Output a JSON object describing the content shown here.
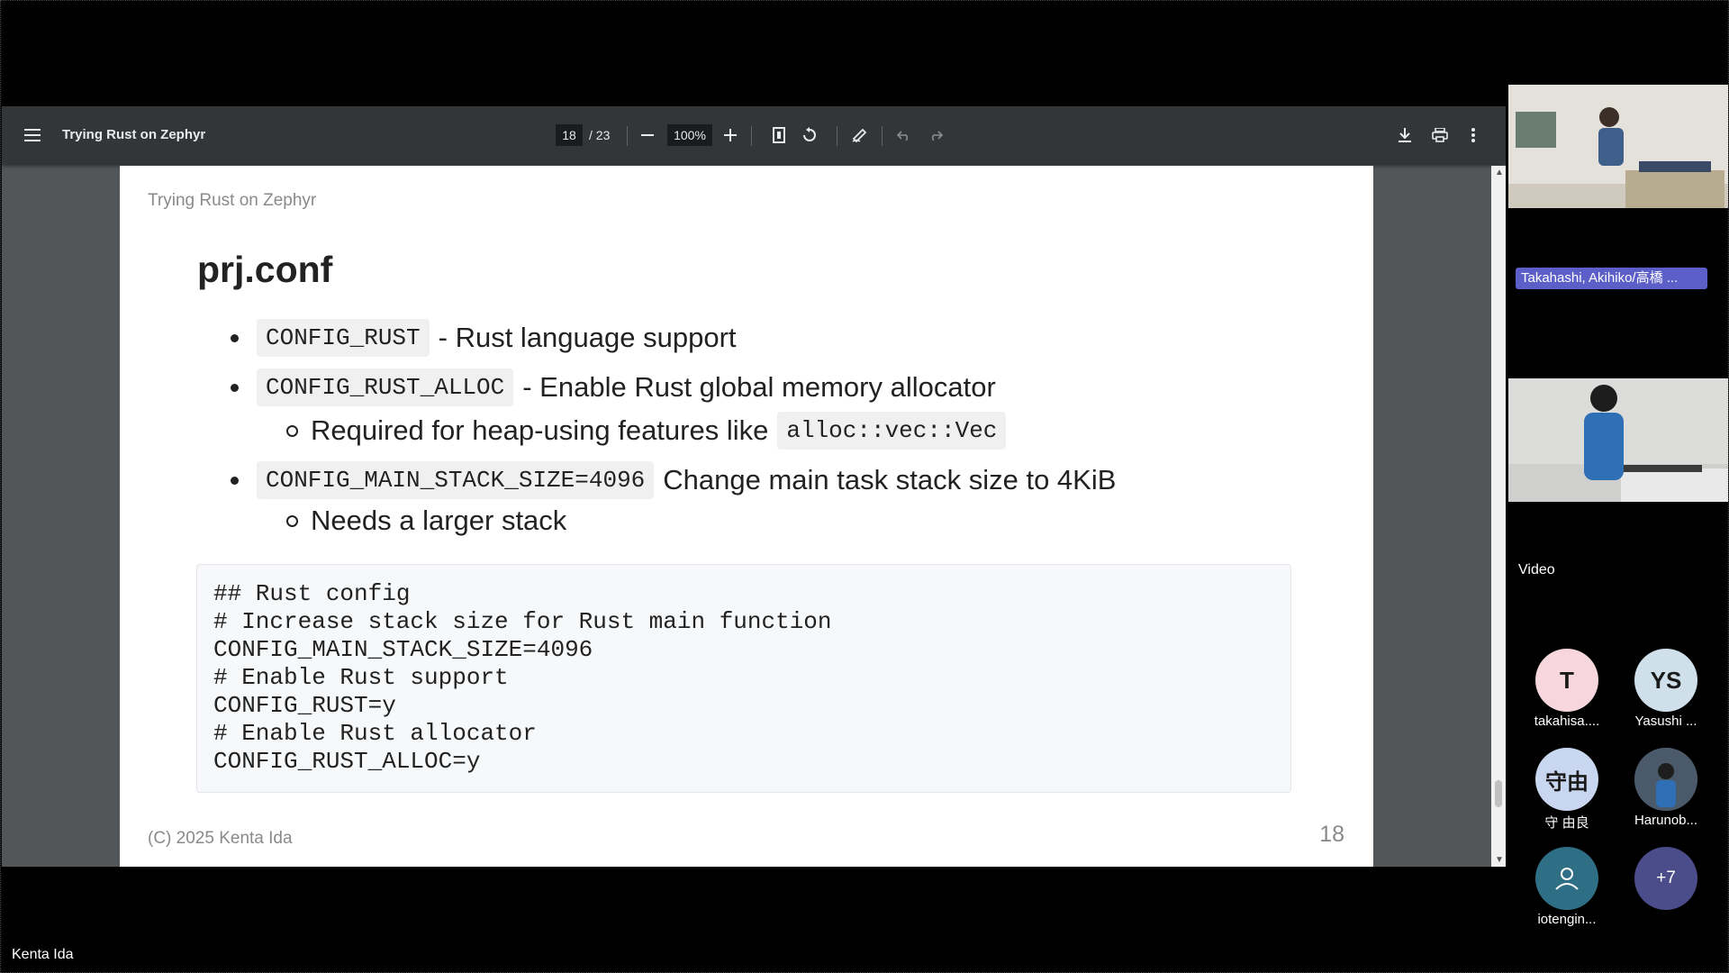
{
  "viewer": {
    "doc_title": "Trying Rust on Zephyr",
    "page_current": "18",
    "page_total": "/ 23",
    "zoom": "100%"
  },
  "page": {
    "header": "Trying Rust on Zephyr",
    "title": "prj.conf",
    "bullets": [
      {
        "code": "CONFIG_RUST",
        "text": "- Rust language support"
      },
      {
        "code": "CONFIG_RUST_ALLOC",
        "text": "- Enable Rust global memory allocator",
        "sub": {
          "text": "Required for heap-using features like",
          "code": "alloc::vec::Vec"
        }
      },
      {
        "code": "CONFIG_MAIN_STACK_SIZE=4096",
        "text": "Change main task stack size to 4KiB",
        "sub": {
          "text": "Needs a larger stack"
        }
      }
    ],
    "code_lines": [
      "## Rust config",
      "# Increase stack size for Rust main function",
      "CONFIG_MAIN_STACK_SIZE=4096",
      "# Enable Rust support",
      "CONFIG_RUST=y",
      "# Enable Rust allocator",
      "CONFIG_RUST_ALLOC=y"
    ],
    "footer": "(C) 2025 Kenta Ida",
    "page_number": "18"
  },
  "meeting": {
    "speaker_banner": "Takahashi, Akihiko/高橋 ...",
    "video_label": "Video",
    "participants": [
      {
        "initials": "T",
        "name": "takahisa....",
        "bg": "#f7d7dd",
        "fg": "#1a1a1a"
      },
      {
        "initials": "YS",
        "name": "Yasushi ...",
        "bg": "#cfe0ea",
        "fg": "#1a1a1a"
      },
      {
        "initials": "守由",
        "name": "守 由良",
        "bg": "#c9d6f0",
        "fg": "#1a1a1a"
      },
      {
        "initials": "",
        "name": "Harunob...",
        "bg": "#3a4a5a",
        "fg": "#ffffff"
      },
      {
        "initials": "",
        "name": "iotengin...",
        "bg": "#2f6f86",
        "fg": "#ffffff"
      },
      {
        "initials": "+7",
        "name": "",
        "bg": "#4b4c8a",
        "fg": "#ffffff"
      }
    ],
    "presenter": "Kenta Ida"
  },
  "icons": {
    "menu": "menu-icon",
    "zoom_out": "minus-icon",
    "zoom_in": "plus-icon",
    "fit": "fit-page-icon",
    "rotate": "rotate-icon",
    "annotate": "pen-icon",
    "undo": "undo-icon",
    "redo": "redo-icon",
    "download": "download-icon",
    "print": "print-icon",
    "more": "more-vert-icon"
  }
}
